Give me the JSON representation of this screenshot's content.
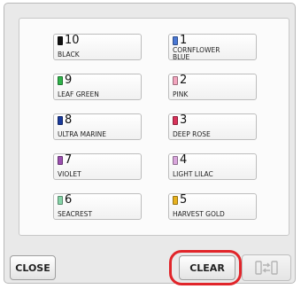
{
  "threads": {
    "left": [
      {
        "number": "10",
        "name": "BLACK",
        "color": "#111111"
      },
      {
        "number": "9",
        "name": "LEAF GREEN",
        "color": "#2fb34a"
      },
      {
        "number": "8",
        "name": "ULTRA MARINE",
        "color": "#1a3a9c"
      },
      {
        "number": "7",
        "name": "VIOLET",
        "color": "#9b4fb0"
      },
      {
        "number": "6",
        "name": "SEACREST",
        "color": "#86d4a8"
      }
    ],
    "right": [
      {
        "number": "1",
        "name": "CORNFLOWER\nBLUE",
        "color": "#4a78d4"
      },
      {
        "number": "2",
        "name": "PINK",
        "color": "#f2a5be"
      },
      {
        "number": "3",
        "name": "DEEP ROSE",
        "color": "#d8325a"
      },
      {
        "number": "4",
        "name": "LIGHT LILAC",
        "color": "#d9a6dc"
      },
      {
        "number": "5",
        "name": "HARVEST GOLD",
        "color": "#e7b11f"
      }
    ]
  },
  "buttons": {
    "close_label": "CLOSE",
    "clear_label": "CLEAR",
    "swap_icon": "thread-swap-icon"
  },
  "colors": {
    "highlight": "#e1252a"
  }
}
